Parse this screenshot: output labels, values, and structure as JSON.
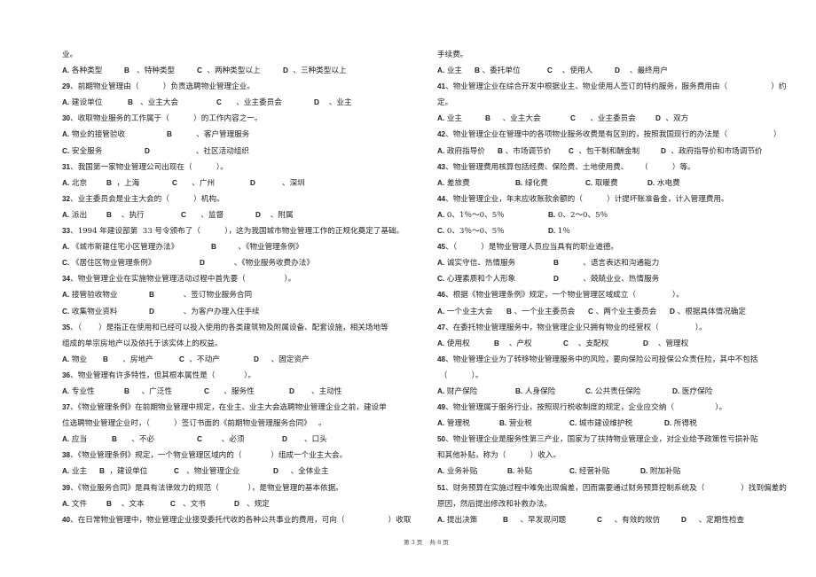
{
  "footer": "第 3 页    共 8 页",
  "left_column": [
    {
      "type": "text",
      "text": "业。"
    },
    {
      "type": "options",
      "opts": [
        {
          "k": "A.",
          "t": " 各种类型",
          "w": 70
        },
        {
          "k": "B",
          "t": "   、特种类型",
          "w": 82
        },
        {
          "k": "C",
          "t": "  、两种类型以上",
          "w": 97
        },
        {
          "k": "D",
          "t": "  、三种类型以上",
          "w": 100
        }
      ]
    },
    {
      "type": "q",
      "num": "29",
      "text": "、前期物业管理由（          ）负责选聘物业管理企业。"
    },
    {
      "type": "options",
      "opts": [
        {
          "k": "A.",
          "t": " 建设单位",
          "w": 74
        },
        {
          "k": "B",
          "t": "   、业主大会",
          "w": 100
        },
        {
          "k": "C",
          "t": "      、业主委员会",
          "w": 110
        },
        {
          "k": "D",
          "t": "    、业主",
          "w": 60
        }
      ]
    },
    {
      "type": "q",
      "num": "30",
      "text": "、收取物业服务的工作属于（          ）的工作内容之一。"
    },
    {
      "type": "options",
      "opts": [
        {
          "k": "A.",
          "t": " 物业的接管验收",
          "w": 118
        },
        {
          "k": "B",
          "t": "          、客户管理服务",
          "w": 150
        }
      ]
    },
    {
      "type": "options",
      "opts": [
        {
          "k": "C.",
          "t": " 安全服务",
          "w": 93
        },
        {
          "k": "D",
          "t": "                   、社区活动组织",
          "w": 160
        }
      ]
    },
    {
      "type": "q",
      "num": "31",
      "text": "、我国第一家物业管理公司出现在（          ）。"
    },
    {
      "type": "options",
      "opts": [
        {
          "k": "A.",
          "t": " 北京",
          "w": 50
        },
        {
          "k": "B",
          "t": "  ，上海",
          "w": 74
        },
        {
          "k": "C",
          "t": "      、广州",
          "w": 88
        },
        {
          "k": "D",
          "t": "           、深圳",
          "w": 80
        }
      ]
    },
    {
      "type": "q",
      "num": "32",
      "text": "、业主委员会是业主大会的（          ）机构。"
    },
    {
      "type": "options",
      "opts": [
        {
          "k": "A.",
          "t": " 派出",
          "w": 50
        },
        {
          "k": "B",
          "t": "    、执行",
          "w": 84
        },
        {
          "k": "C",
          "t": "      、监督",
          "w": 84
        },
        {
          "k": "D",
          "t": "    、附属",
          "w": 60
        }
      ]
    },
    {
      "type": "q",
      "num": "33",
      "text": "、1994 年建设部第  33 号令颁布了（          ），这为我国城市物业管理工作的正规化奠定了基础。"
    },
    {
      "type": "options",
      "opts": [
        {
          "k": "A.",
          "t": " 《城市新建住宅小区管理办法》",
          "w": 168
        },
        {
          "k": "B",
          "t": "         、《物业管理条例》",
          "w": 140
        }
      ]
    },
    {
      "type": "options",
      "opts": [
        {
          "k": "C.",
          "t": " 《居住区物业管理条例》",
          "w": 155
        },
        {
          "k": "D",
          "t": "            、《物业服务收费办法》",
          "w": 150
        }
      ]
    },
    {
      "type": "q",
      "num": "34",
      "text": "、物业管理企业在实施物业管理活动过程中首先要（                ）。"
    },
    {
      "type": "options",
      "opts": [
        {
          "k": "A.",
          "t": " 接管验收物业",
          "w": 98
        },
        {
          "k": "B",
          "t": "            、签订物业服务合同",
          "w": 150
        }
      ]
    },
    {
      "type": "options",
      "opts": [
        {
          "k": "C.",
          "t": " 收集物业资料",
          "w": 98
        },
        {
          "k": "D",
          "t": "            、为客户办理入住手续",
          "w": 150
        }
      ]
    },
    {
      "type": "q",
      "num": "35",
      "text": "、（       ）是指正在使用和已经可以投入使用的各类建筑物及附属设备、配套设施，相关场地等"
    },
    {
      "type": "text",
      "text": "组成的单宗房地产以及依托于该实体上的权益。"
    },
    {
      "type": "options",
      "opts": [
        {
          "k": "A.",
          "t": " 物业",
          "w": 46
        },
        {
          "k": "B",
          "t": "      、房地产",
          "w": 86
        },
        {
          "k": "C",
          "t": "  、不动产",
          "w": 84
        },
        {
          "k": "D",
          "t": "     、固定资产",
          "w": 80
        }
      ]
    },
    {
      "type": "q",
      "num": "36",
      "text": "、物业管理有许多特性，但其根本属性是（            ）。"
    },
    {
      "type": "options",
      "opts": [
        {
          "k": "A.",
          "t": " 专业性",
          "w": 70
        },
        {
          "k": "B",
          "t": "     、广泛性",
          "w": 90
        },
        {
          "k": "C",
          "t": "      、服务性",
          "w": 96
        },
        {
          "k": "D",
          "t": "       、主动性",
          "w": 80
        }
      ]
    },
    {
      "type": "q",
      "num": "37",
      "text": "、《物业管理条例》在前期物业管理中规定，在业主、业主大会选聘物业管理企业之前，建设单"
    },
    {
      "type": "text",
      "text": "位选聘物业管理企业时，（          ）签订书面的《前期物业管理服务合同》   。"
    },
    {
      "type": "options",
      "opts": [
        {
          "k": "A.",
          "t": " 应当",
          "w": 56
        },
        {
          "k": "B",
          "t": "      、不必",
          "w": 96
        },
        {
          "k": "C",
          "t": "        、必须",
          "w": 96
        },
        {
          "k": "D",
          "t": "       、口头",
          "w": 80
        }
      ]
    },
    {
      "type": "q",
      "num": "38",
      "text": "、《物业管理条例》规定，一个物业管理区域内的（            ）组成一个业主大会。"
    },
    {
      "type": "options",
      "opts": [
        {
          "k": "A.",
          "t": " 业主",
          "w": 42
        },
        {
          "k": "B",
          "t": "  ，建设单位",
          "w": 84
        },
        {
          "k": "C",
          "t": "   、物业管理企业",
          "w": 112
        },
        {
          "k": "D",
          "t": "     、全体业主",
          "w": 80
        }
      ]
    },
    {
      "type": "q",
      "num": "39",
      "text": "、《物业服务合同》是具有法律效力的规范（            ），是物业管理的基本依据。"
    },
    {
      "type": "options",
      "opts": [
        {
          "k": "A.",
          "t": " 文件",
          "w": 50
        },
        {
          "k": "B",
          "t": "    、文本",
          "w": 72
        },
        {
          "k": "C",
          "t": "   、文书",
          "w": 72
        },
        {
          "k": "D",
          "t": "   、规定",
          "w": 60
        }
      ]
    },
    {
      "type": "q",
      "num": "40",
      "text": "、在日常物业管理中，物业管理企业接受委托代收的各种公共事业的费用，可向（                  ）收取"
    }
  ],
  "right_column": [
    {
      "type": "text",
      "text": "手续费。"
    },
    {
      "type": "options",
      "opts": [
        {
          "k": "A.",
          "t": " 业主",
          "w": 42
        },
        {
          "k": "B",
          "t": " 、委托单位",
          "w": 82
        },
        {
          "k": "C",
          "t": "    、使用人",
          "w": 76
        },
        {
          "k": "D",
          "t": "    、最终用户",
          "w": 80
        }
      ]
    },
    {
      "type": "q",
      "num": "41",
      "text": "、物业管理企业在综合开发中根据业主、物业使用人签订的特约服务，服务费用由（                  ）约"
    },
    {
      "type": "text",
      "text": "定。"
    },
    {
      "type": "options",
      "opts": [
        {
          "k": "A.",
          "t": " 业主",
          "w": 54
        },
        {
          "k": "B",
          "t": "     、业主大会",
          "w": 96
        },
        {
          "k": "C",
          "t": "      、业主委员会",
          "w": 96
        },
        {
          "k": "D",
          "t": "  、双方",
          "w": 60
        }
      ]
    },
    {
      "type": "q",
      "num": "42",
      "text": "、物业管理企业在管理中的各项物业服务收费是有区别的，按照我国现行的办法是（                   ）"
    },
    {
      "type": "options",
      "opts": [
        {
          "k": "A.",
          "t": " 政府指导价",
          "w": 68
        },
        {
          "k": "B",
          "t": " 、市场调节价",
          "w": 80
        },
        {
          "k": "C",
          "t": "  、包干制和酬金制",
          "w": 104
        },
        {
          "k": "D",
          "t": "  、政府指导价和市场调节价",
          "w": 140
        }
      ]
    },
    {
      "type": "q",
      "num": "43",
      "text": "、物业管理费用核算包括经费、保险费、土地使用费、     （          ）等。"
    },
    {
      "type": "options",
      "opts": [
        {
          "k": "A.",
          "t": " 差旅费",
          "w": 88
        },
        {
          "k": "B.",
          "t": " 绿化费",
          "w": 79
        },
        {
          "k": "C.",
          "t": " 取暖费",
          "w": 70
        },
        {
          "k": "D.",
          "t": " 水电费",
          "w": 60
        }
      ]
    },
    {
      "type": "q",
      "num": "44",
      "text": "、物业管理企业，年末应收账款余额的（          ）计提坏账准备金，计入管理费用。"
    },
    {
      "type": "options",
      "opts": [
        {
          "k": "A.",
          "t": " 0、1％～0、5％",
          "w": 125
        },
        {
          "k": "B.",
          "t": " 0、2～0、5％",
          "w": 100
        }
      ]
    },
    {
      "type": "options",
      "opts": [
        {
          "k": "C.",
          "t": " 0、3％～0、5％",
          "w": 125
        },
        {
          "k": "D.",
          "t": " 1％",
          "w": 40
        }
      ]
    },
    {
      "type": "q",
      "num": "45",
      "text": "、（          ）是物业管理人员应当具有的职业道德。"
    },
    {
      "type": "options",
      "opts": [
        {
          "k": "A.",
          "t": " 诚实守信、热情服务",
          "w": 131
        },
        {
          "k": "B",
          "t": "          、语言表达和沟通能力",
          "w": 150
        }
      ]
    },
    {
      "type": "options",
      "opts": [
        {
          "k": "C.",
          "t": " 心理素质和个人形象",
          "w": 131
        },
        {
          "k": "D",
          "t": "          、兢兢业业、热情服务",
          "w": 150
        }
      ]
    },
    {
      "type": "q",
      "num": "46",
      "text": "、根据《物业管理条例》规定，一个物业管理区域成立（               ）。"
    },
    {
      "type": "options",
      "opts": [
        {
          "k": "A.",
          "t": " 一个业主大会",
          "w": 78
        },
        {
          "k": "B",
          "t": " 、一个业主委员会",
          "w": 92
        },
        {
          "k": "C",
          "t": " 、两个业主委员会",
          "w": 92
        },
        {
          "k": "D",
          "t": " 、根据具体情况确定",
          "w": 110
        }
      ]
    },
    {
      "type": "q",
      "num": "47",
      "text": "、在委托物业管理服务中，物业管理企业只拥有物业的经营权（               ）。"
    },
    {
      "type": "options",
      "opts": [
        {
          "k": "A.",
          "t": " 使用权",
          "w": 64
        },
        {
          "k": "B",
          "t": "    、产权",
          "w": 78
        },
        {
          "k": "C",
          "t": "    、支配权",
          "w": 90
        },
        {
          "k": "D",
          "t": "    、管理权",
          "w": 70
        }
      ]
    },
    {
      "type": "q",
      "num": "48",
      "text": "、物业管理企业为了转移物业管理服务中的风险，要向保险公司投保公众责任险，其中不包括"
    },
    {
      "type": "text",
      "text": " （          ）。"
    },
    {
      "type": "options",
      "opts": [
        {
          "k": "A.",
          "t": " 财产保险",
          "w": 88
        },
        {
          "k": "B.",
          "t": " 人身保险",
          "w": 79
        },
        {
          "k": "C.",
          "t": " 公共责任保险",
          "w": 98
        },
        {
          "k": "D.",
          "t": " 医疗保险",
          "w": 60
        }
      ]
    },
    {
      "type": "q",
      "num": "49",
      "text": "、物业管理属于服务行业，按照现行税收制度的规定，企业应交纳（                 ）。"
    },
    {
      "type": "options",
      "opts": [
        {
          "k": "A.",
          "t": " 管理税",
          "w": 70
        },
        {
          "k": "B.",
          "t": " 营业税",
          "w": 79
        },
        {
          "k": "C.",
          "t": " 城市建设维护税",
          "w": 107
        },
        {
          "k": "D.",
          "t": " 所得税",
          "w": 60
        }
      ]
    },
    {
      "type": "q",
      "num": "50",
      "text": "、物业管理企业是服务性第三产业，国家为了扶持物业管理企业，对企业给予政策性亏损补贴"
    },
    {
      "type": "text",
      "text": "和其他补贴，称为（          ）收入。"
    },
    {
      "type": "options",
      "opts": [
        {
          "k": "A.",
          "t": " 业务补贴",
          "w": 79
        },
        {
          "k": "B.",
          "t": " 补贴",
          "w": 70
        },
        {
          "k": "C.",
          "t": " 经营补贴",
          "w": 80
        },
        {
          "k": "D.",
          "t": " 附加补贴",
          "w": 60
        }
      ]
    },
    {
      "type": "q",
      "num": "51",
      "text": "、财务预算在实施过程中难免出现偏差，因而需要通过财务预算控制系统及（               ）找到偏差的"
    },
    {
      "type": "text",
      "text": "原因，然后提出修改和补救办法。"
    },
    {
      "type": "options",
      "opts": [
        {
          "k": "A.",
          "t": " 提出决策",
          "w": 74
        },
        {
          "k": "B",
          "t": "     、早发现问题",
          "w": 106
        },
        {
          "k": "C",
          "t": "     、有效的效仿",
          "w": 95
        },
        {
          "k": "D",
          "t": "     、定期性检查",
          "w": 80
        }
      ]
    }
  ]
}
